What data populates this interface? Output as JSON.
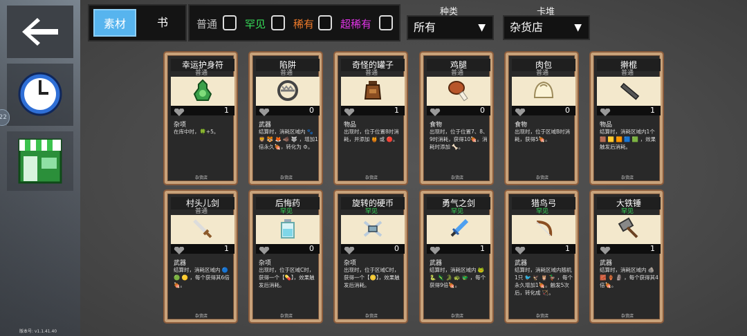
{
  "nav": {
    "back_icon": "back-arrow-icon",
    "clock_icon": "clock-icon",
    "shop_icon": "shop-icon",
    "side_tab": "22",
    "version": "版本号:  v1.1.41.40"
  },
  "tabs": {
    "active": "素材",
    "inactive": "书"
  },
  "rarity_filter": {
    "common": "普通",
    "uncommon": "罕见",
    "rare": "稀有",
    "epic": "超稀有",
    "colors": {
      "common": "#bfbfbf",
      "uncommon": "#37e05a",
      "rare": "#ee7a2a",
      "epic": "#e034e6"
    }
  },
  "kind": {
    "label": "种类",
    "value": "所有"
  },
  "deck": {
    "label": "卡堆",
    "value": "杂货店"
  },
  "cards": [
    {
      "name": "幸运护身符",
      "rarity": "普通",
      "cost": "1",
      "category": "杂项",
      "desc": "在库中时，🍀+5。",
      "footer": "杂货店",
      "icon": "amulet-icon",
      "rare": false
    },
    {
      "name": "陷阱",
      "rarity": "普通",
      "cost": "0",
      "category": "武器",
      "desc": "结算时，消耗区域内 🐾 🦁 🐯 🦊 🐗 🐺 ，增加1倍永久🍖，转化为 ⚙。",
      "footer": "杂货店",
      "icon": "trap-icon",
      "rare": false
    },
    {
      "name": "奇怪的罐子",
      "rarity": "普通",
      "cost": "1",
      "category": "物品",
      "desc": "出现时，位于位置8时消耗，并添加 🍯 或 🔴。",
      "footer": "杂货店",
      "icon": "jar-icon",
      "rare": false
    },
    {
      "name": "鸡腿",
      "rarity": "普通",
      "cost": "0",
      "category": "食物",
      "desc": "出现时，位于位置7、8、9时消耗，获得10🍖。消耗时添加 🦴。",
      "footer": "杂货店",
      "icon": "drumstick-icon",
      "rare": false
    },
    {
      "name": "肉包",
      "rarity": "普通",
      "cost": "0",
      "category": "食物",
      "desc": "出现时，位于区域B时消耗，获得5🍖。",
      "footer": "杂货店",
      "icon": "bun-icon",
      "rare": false
    },
    {
      "name": "擀棍",
      "rarity": "普通",
      "cost": "1",
      "category": "物品",
      "desc": "结算时，消耗区域内1个 🟫 🟨 🟧 🟦 🟩 ，效果触发后消耗。",
      "footer": "杂货店",
      "icon": "rolling-pin-icon",
      "rare": false
    },
    {
      "name": "村头儿剑",
      "rarity": "普通",
      "cost": "1",
      "category": "武器",
      "desc": "结算时，消耗区域内 🔵 🟢 🟡 ，每个获得其6倍🍖。",
      "footer": "杂货店",
      "icon": "sword-icon",
      "rare": false
    },
    {
      "name": "后悔药",
      "rarity": "罕见",
      "cost": "0",
      "category": "杂项",
      "desc": "出现时，位于区域C时，获得一个【💊】，效果触发后消耗。",
      "footer": "杂货店",
      "icon": "potion-icon",
      "rare": true
    },
    {
      "name": "旋转的硬币",
      "rarity": "罕见",
      "cost": "0",
      "category": "杂项",
      "desc": "出现时，位于区域C时，获得一个【🪙】，效果触发后消耗。",
      "footer": "杂货店",
      "icon": "coin-icon",
      "rare": true
    },
    {
      "name": "勇气之剑",
      "rarity": "罕见",
      "cost": "1",
      "category": "武器",
      "desc": "结算时，消耗区域内 🐸 🐍 🦎 🐊 🐢 🐲 ，每个获得9倍🍖。",
      "footer": "杂货店",
      "icon": "blue-sword-icon",
      "rare": true
    },
    {
      "name": "猎鸟弓",
      "rarity": "罕见",
      "cost": "1",
      "category": "武器",
      "desc": "结算时，消耗区域内随机1只 🐦 🦅 🦉 🦆 ，每个永久增加1🍖。触发5次后，转化成 🏹。",
      "footer": "杂货店",
      "icon": "bow-icon",
      "rare": true
    },
    {
      "name": "大铁锤",
      "rarity": "罕见",
      "cost": "1",
      "category": "武器",
      "desc": "结算时，消耗区域内 🪨 🧱 🏺 🗿 ，每个获得其4倍🍖。",
      "footer": "杂货店",
      "icon": "hammer-icon",
      "rare": true
    }
  ]
}
